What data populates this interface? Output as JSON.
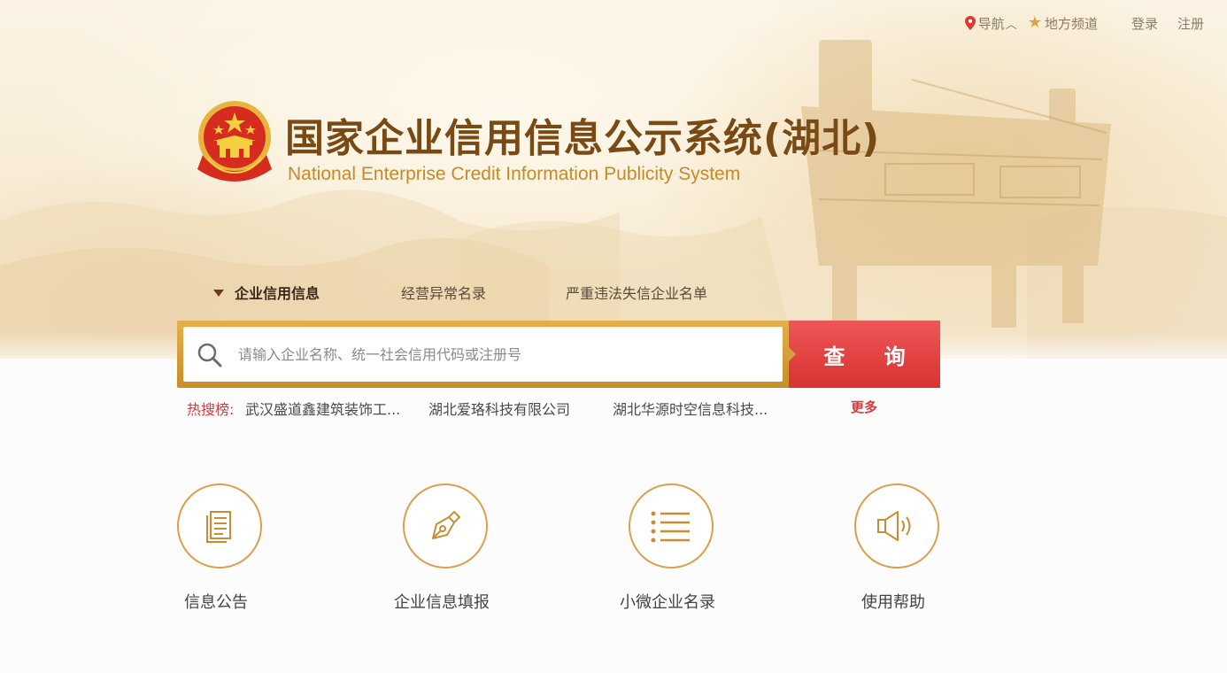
{
  "topbar": {
    "nav_label": "导航",
    "channel_label": "地方频道",
    "login_label": "登录",
    "register_label": "注册"
  },
  "header": {
    "title_cn": "国家企业信用信息公示系统(湖北)",
    "title_en": "National Enterprise Credit Information Publicity System"
  },
  "search": {
    "tabs": [
      {
        "label": "企业信用信息",
        "active": true
      },
      {
        "label": "经营异常名录",
        "active": false
      },
      {
        "label": "严重违法失信企业名单",
        "active": false
      }
    ],
    "placeholder": "请输入企业名称、统一社会信用代码或注册号",
    "button_label": "查 询"
  },
  "hot": {
    "label": "热搜榜:",
    "items": [
      "武汉盛道鑫建筑装饰工...",
      "湖北爱珞科技有限公司",
      "湖北华源时空信息科技..."
    ],
    "more_label": "更多"
  },
  "services": [
    {
      "label": "信息公告",
      "icon": "document-icon"
    },
    {
      "label": "企业信息填报",
      "icon": "pen-icon"
    },
    {
      "label": "小微企业名录",
      "icon": "list-icon"
    },
    {
      "label": "使用帮助",
      "icon": "speaker-icon"
    }
  ],
  "colors": {
    "accent_gold": "#d9a04e",
    "title_brown": "#7a4a14",
    "button_red": "#e04545",
    "hot_red": "#d63a3a"
  }
}
